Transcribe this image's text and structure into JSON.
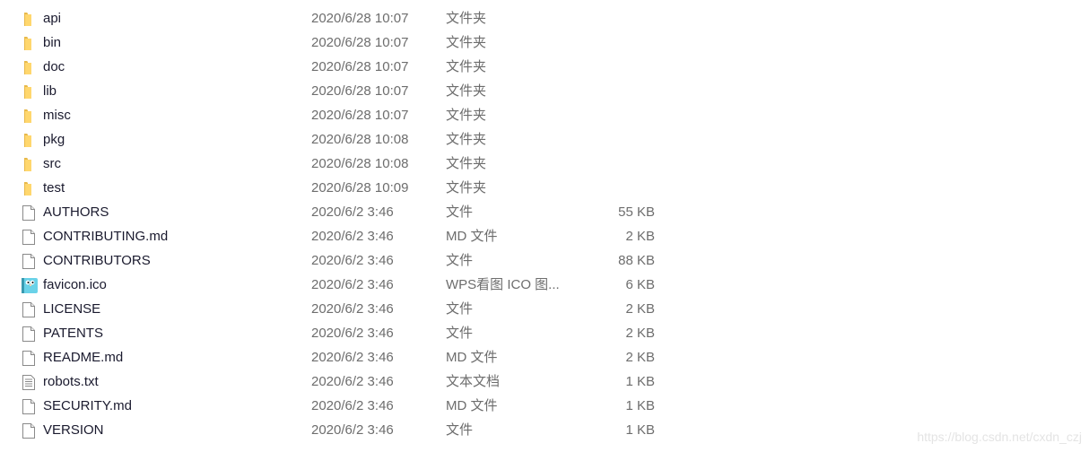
{
  "files": [
    {
      "name": "api",
      "date": "2020/6/28 10:07",
      "type": "文件夹",
      "size": "",
      "icon": "folder-icon"
    },
    {
      "name": "bin",
      "date": "2020/6/28 10:07",
      "type": "文件夹",
      "size": "",
      "icon": "folder-icon"
    },
    {
      "name": "doc",
      "date": "2020/6/28 10:07",
      "type": "文件夹",
      "size": "",
      "icon": "folder-icon"
    },
    {
      "name": "lib",
      "date": "2020/6/28 10:07",
      "type": "文件夹",
      "size": "",
      "icon": "folder-icon"
    },
    {
      "name": "misc",
      "date": "2020/6/28 10:07",
      "type": "文件夹",
      "size": "",
      "icon": "folder-icon"
    },
    {
      "name": "pkg",
      "date": "2020/6/28 10:08",
      "type": "文件夹",
      "size": "",
      "icon": "folder-icon"
    },
    {
      "name": "src",
      "date": "2020/6/28 10:08",
      "type": "文件夹",
      "size": "",
      "icon": "folder-icon"
    },
    {
      "name": "test",
      "date": "2020/6/28 10:09",
      "type": "文件夹",
      "size": "",
      "icon": "folder-icon"
    },
    {
      "name": "AUTHORS",
      "date": "2020/6/2 3:46",
      "type": "文件",
      "size": "55 KB",
      "icon": "file-icon"
    },
    {
      "name": "CONTRIBUTING.md",
      "date": "2020/6/2 3:46",
      "type": "MD 文件",
      "size": "2 KB",
      "icon": "file-icon"
    },
    {
      "name": "CONTRIBUTORS",
      "date": "2020/6/2 3:46",
      "type": "文件",
      "size": "88 KB",
      "icon": "file-icon"
    },
    {
      "name": "favicon.ico",
      "date": "2020/6/2 3:46",
      "type": "WPS看图 ICO 图...",
      "size": "6 KB",
      "icon": "gopher-image-icon"
    },
    {
      "name": "LICENSE",
      "date": "2020/6/2 3:46",
      "type": "文件",
      "size": "2 KB",
      "icon": "file-icon"
    },
    {
      "name": "PATENTS",
      "date": "2020/6/2 3:46",
      "type": "文件",
      "size": "2 KB",
      "icon": "file-icon"
    },
    {
      "name": "README.md",
      "date": "2020/6/2 3:46",
      "type": "MD 文件",
      "size": "2 KB",
      "icon": "file-icon"
    },
    {
      "name": "robots.txt",
      "date": "2020/6/2 3:46",
      "type": "文本文档",
      "size": "1 KB",
      "icon": "text-file-icon"
    },
    {
      "name": "SECURITY.md",
      "date": "2020/6/2 3:46",
      "type": "MD 文件",
      "size": "1 KB",
      "icon": "file-icon"
    },
    {
      "name": "VERSION",
      "date": "2020/6/2 3:46",
      "type": "文件",
      "size": "1 KB",
      "icon": "file-icon"
    }
  ],
  "watermark": "https://blog.csdn.net/cxdn_czj"
}
